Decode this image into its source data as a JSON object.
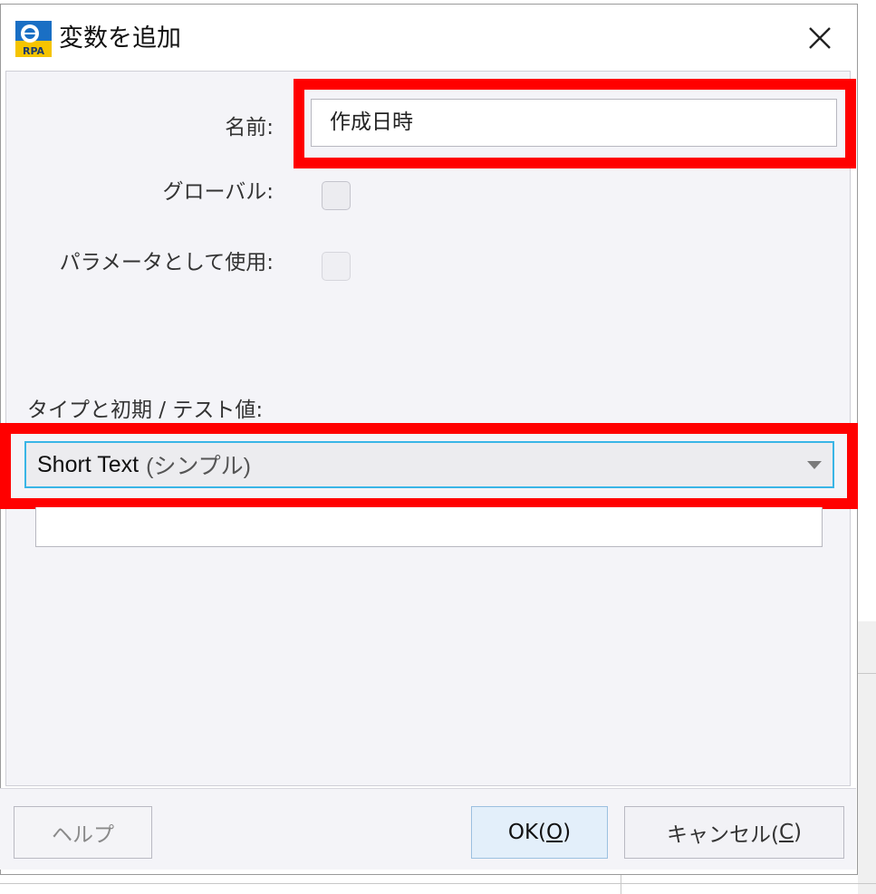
{
  "dialog": {
    "title": "変数を追加",
    "icon_name": "rpa-app-icon",
    "icon_text": "RPA",
    "close_icon": "close-icon"
  },
  "form": {
    "name_label": "名前:",
    "name_value": "作成日時",
    "global_label": "グローバル:",
    "param_label": "パラメータとして使用:",
    "type_label": "タイプと初期 / テスト値:",
    "type_select": {
      "value_main": "Short Text",
      "value_sub": "(シンプル)"
    }
  },
  "buttons": {
    "help": "ヘルプ",
    "ok_prefix": "OK(",
    "ok_key": "O",
    "ok_suffix": ")",
    "cancel_prefix": "キャンセル(",
    "cancel_key": "C",
    "cancel_suffix": ")"
  },
  "colors": {
    "highlight": "#ff0000",
    "focus_border": "#39b5e6",
    "icon_blue": "#1a6fc4",
    "icon_yellow": "#f5c400"
  }
}
